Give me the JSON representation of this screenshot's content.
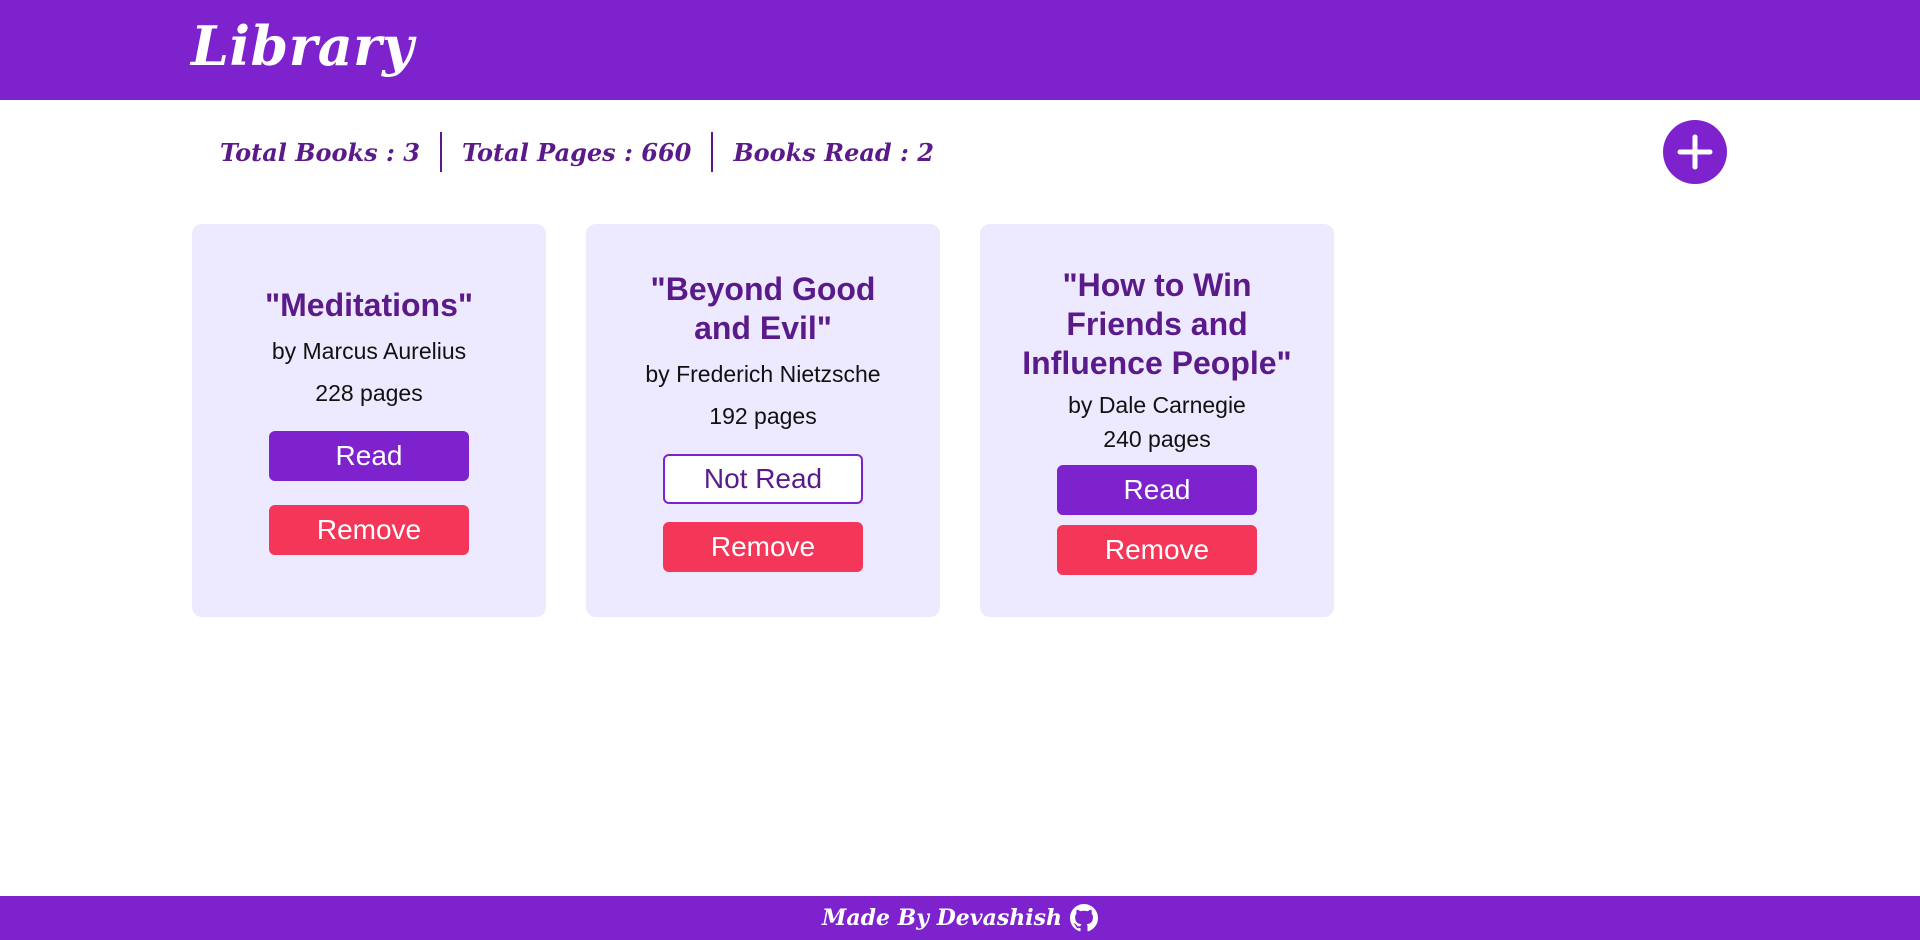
{
  "header": {
    "title": "Library"
  },
  "stats": {
    "total_books": "Total Books : 3",
    "total_pages": "Total Pages : 660",
    "books_read": "Books Read : 2"
  },
  "books": [
    {
      "title": "\"Meditations\"",
      "author": "by Marcus Aurelius",
      "pages": "228 pages",
      "status_label": "Read",
      "remove_label": "Remove"
    },
    {
      "title": "\"Beyond Good and Evil\"",
      "author": "by Frederich Nietzsche",
      "pages": "192 pages",
      "status_label": "Not Read",
      "remove_label": "Remove"
    },
    {
      "title": "\"How to Win Friends and Influence People\"",
      "author": "by Dale Carnegie",
      "pages": "240 pages",
      "status_label": "Read",
      "remove_label": "Remove"
    }
  ],
  "footer": {
    "text": "Made By Devashish",
    "icon": "github-icon"
  },
  "colors": {
    "primary": "#7e22ce",
    "card_bg": "#ede9fe",
    "title_text": "#5b1a8a",
    "remove": "#f43658"
  }
}
